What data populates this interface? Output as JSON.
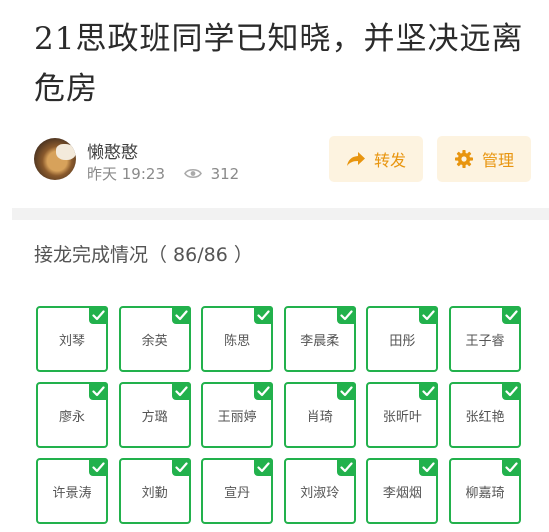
{
  "post": {
    "title": "21思政班同学已知晓，并坚决远离危房",
    "author": "懒憨憨",
    "time": "昨天 19:23",
    "views": "312"
  },
  "actions": {
    "share_label": "转发",
    "manage_label": "管理"
  },
  "section": {
    "title": "接龙完成情况（ 86/86 ）"
  },
  "participants": [
    "刘琴",
    "余英",
    "陈思",
    "李晨柔",
    "田彤",
    "王子睿",
    "廖永",
    "方璐",
    "王丽婷",
    "肖琦",
    "张昕叶",
    "张红艳",
    "许景涛",
    "刘勤",
    "宣丹",
    "刘淑玲",
    "李烟烟",
    "柳嘉琦"
  ],
  "colors": {
    "accent_green": "#22b14c",
    "button_bg": "#fdf3e0",
    "button_text": "#e8950f"
  }
}
